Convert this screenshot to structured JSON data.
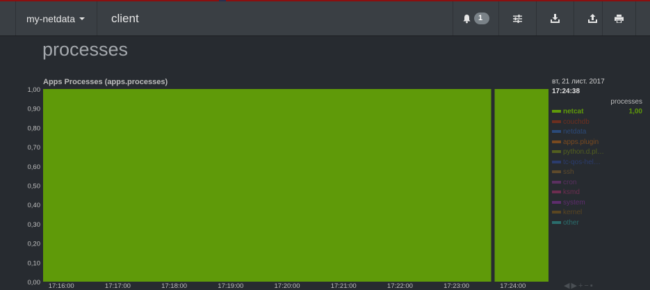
{
  "header": {
    "brand": "my-netdata",
    "host": "client",
    "alerts_count": "1",
    "icons": [
      "bell-icon",
      "sliders-icon",
      "download-icon",
      "upload-icon",
      "print-icon"
    ]
  },
  "section": {
    "title": "processes"
  },
  "chart": {
    "title": "Apps Processes (apps.processes)",
    "legend_date": "вт, 21 лист. 2017",
    "legend_time": "17:24:38",
    "units": "processes"
  },
  "chart_data": {
    "type": "area",
    "title": "Apps Processes (apps.processes)",
    "ylabel": "processes",
    "ylim": [
      0,
      1
    ],
    "y_ticks": [
      "1,00",
      "0,90",
      "0,80",
      "0,70",
      "0,60",
      "0,50",
      "0,40",
      "0,30",
      "0,20",
      "0,10",
      "0,00"
    ],
    "x_ticks": [
      "17:16:00",
      "17:17:00",
      "17:18:00",
      "17:19:00",
      "17:20:00",
      "17:21:00",
      "17:22:00",
      "17:23:00",
      "17:24:00"
    ],
    "gaps": [
      "17:23:38"
    ],
    "series": [
      {
        "name": "netcat",
        "value": "1,00",
        "color": "#5f9a09",
        "active": true
      },
      {
        "name": "couchdb",
        "value": "",
        "color": "#6d2f1f"
      },
      {
        "name": "netdata",
        "value": "",
        "color": "#2b4a7a"
      },
      {
        "name": "apps.plugin",
        "value": "",
        "color": "#7a4a1f"
      },
      {
        "name": "python.d.pl…",
        "value": "",
        "color": "#535f1f"
      },
      {
        "name": "tc-qos-hel…",
        "value": "",
        "color": "#2b3c6d"
      },
      {
        "name": "ssh",
        "value": "",
        "color": "#5e4a2b"
      },
      {
        "name": "cron",
        "value": "",
        "color": "#5a3060"
      },
      {
        "name": "ksmd",
        "value": "",
        "color": "#6d2d50"
      },
      {
        "name": "system",
        "value": "",
        "color": "#5e2d6d"
      },
      {
        "name": "kernel",
        "value": "",
        "color": "#5b4621"
      },
      {
        "name": "other",
        "value": "",
        "color": "#2a6d6d"
      }
    ]
  },
  "toolbar": {
    "icons": [
      "rewind-icon",
      "forward-icon",
      "zoom-in-icon",
      "zoom-out-icon",
      "reset-icon"
    ]
  },
  "colors": {
    "page_bg": "#272b30",
    "navbar_bg": "#3a3f44",
    "area_fill": "#5f9a09",
    "top_strip": [
      "#8a0f0f",
      "#2a2d4f",
      "#8a0f0f"
    ]
  }
}
